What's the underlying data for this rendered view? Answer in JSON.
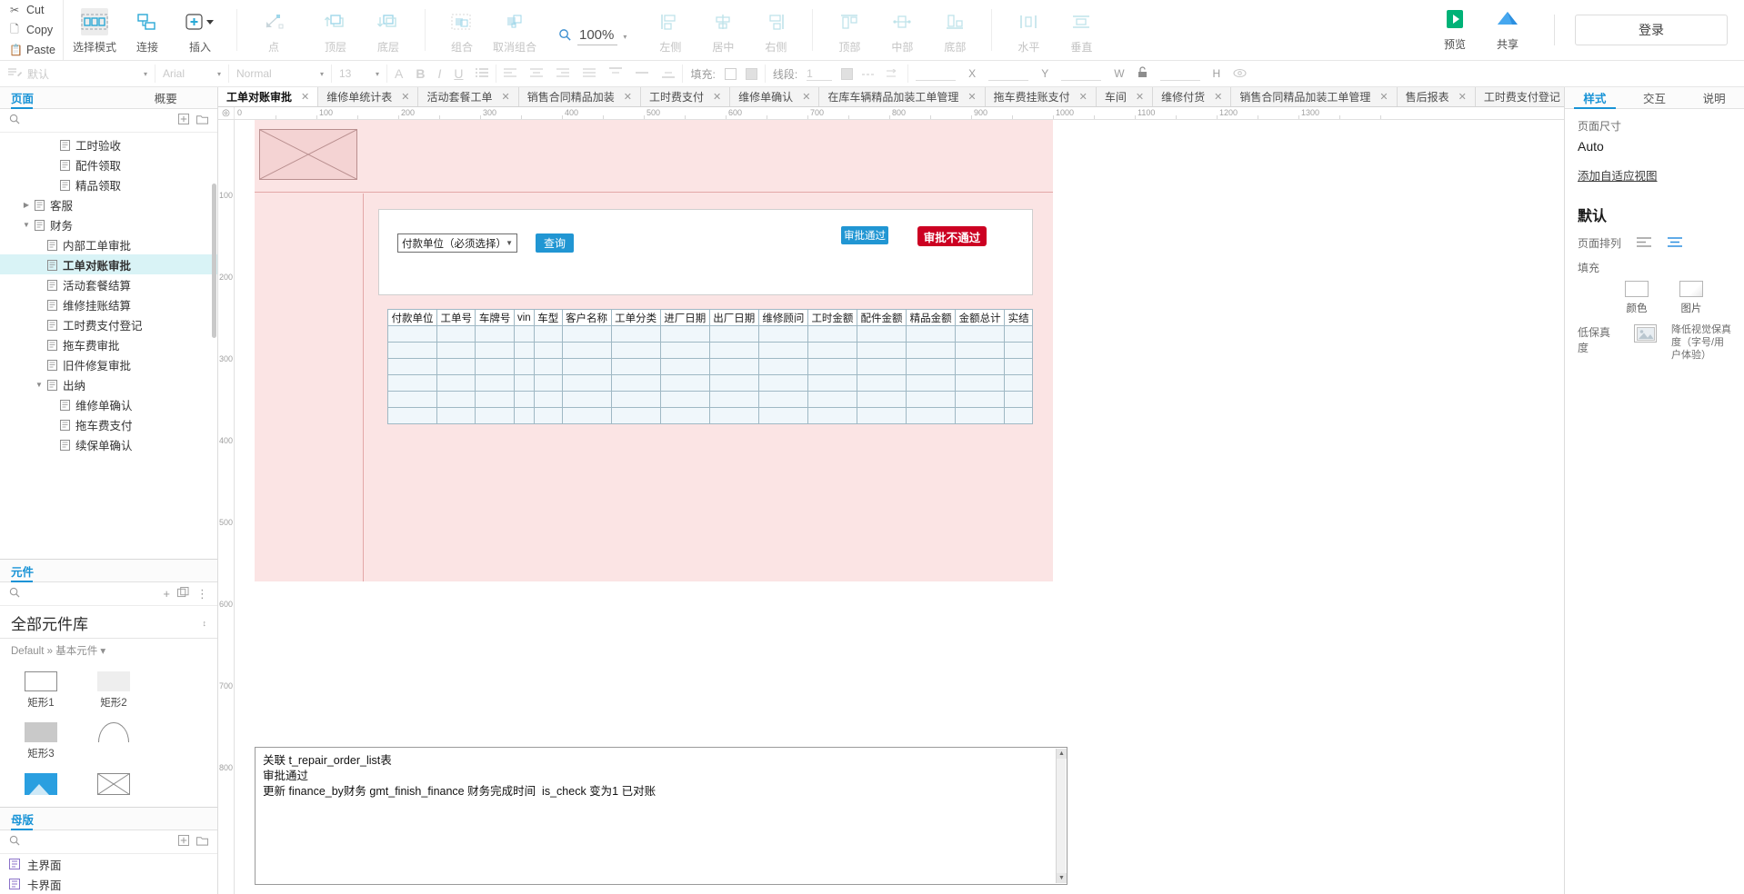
{
  "toolbar": {
    "clipboard": [
      {
        "label": "Cut",
        "icon": "scissors-icon"
      },
      {
        "label": "Copy",
        "icon": "copy-icon"
      },
      {
        "label": "Paste",
        "icon": "clipboard-icon"
      }
    ],
    "groups": [
      {
        "items": [
          {
            "label": "选择模式",
            "icon": "selection-mode-icon",
            "dim": false,
            "selected": true
          },
          {
            "label": "连接",
            "icon": "connect-icon",
            "dim": false,
            "selected": false
          },
          {
            "label": "插入",
            "icon": "insert-plus-icon",
            "dim": false,
            "selected": false,
            "caret": true
          }
        ]
      },
      {
        "items": [
          {
            "label": "点",
            "icon": "point-icon",
            "dim": true,
            "selected": false
          }
        ]
      },
      {
        "items": [
          {
            "label": "顶层",
            "icon": "bring-front-icon",
            "dim": true,
            "selected": false
          },
          {
            "label": "底层",
            "icon": "send-back-icon",
            "dim": true,
            "selected": false
          }
        ]
      },
      {
        "items": [
          {
            "label": "组合",
            "icon": "group-icon",
            "dim": true,
            "selected": false
          },
          {
            "label": "取消组合",
            "icon": "ungroup-icon",
            "dim": true,
            "selected": false
          }
        ]
      }
    ],
    "zoom": {
      "icon": "magnifier-icon",
      "value": "100%"
    },
    "align_groups": [
      {
        "items": [
          {
            "label": "左侧",
            "icon": "align-left-icon"
          },
          {
            "label": "居中",
            "icon": "align-center-icon"
          },
          {
            "label": "右侧",
            "icon": "align-right-icon"
          }
        ]
      },
      {
        "items": [
          {
            "label": "顶部",
            "icon": "align-top-icon"
          },
          {
            "label": "中部",
            "icon": "align-middle-icon"
          },
          {
            "label": "底部",
            "icon": "align-bottom-icon"
          }
        ]
      },
      {
        "items": [
          {
            "label": "水平",
            "icon": "distribute-horizontal-icon"
          },
          {
            "label": "垂直",
            "icon": "distribute-vertical-icon"
          }
        ]
      }
    ],
    "publish": [
      {
        "label": "预览",
        "icon": "preview-play-icon"
      },
      {
        "label": "共享",
        "icon": "share-cloud-icon"
      }
    ],
    "login_label": "登录"
  },
  "format_bar": {
    "style_icon": "text-style-icon",
    "style_value": "默认",
    "font_family": "Arial",
    "font_weight": "Normal",
    "font_size": "13",
    "text_buttons": [
      {
        "icon": "font-color-icon",
        "label": "A"
      },
      {
        "icon": "bold-icon",
        "label": "B"
      },
      {
        "icon": "italic-icon",
        "label": "I"
      },
      {
        "icon": "underline-icon",
        "label": "U"
      },
      {
        "icon": "bullet-list-icon",
        "label": "≔"
      }
    ],
    "align_buttons": [
      {
        "icon": "text-align-left-icon"
      },
      {
        "icon": "text-align-center-icon"
      },
      {
        "icon": "text-align-right-icon"
      },
      {
        "icon": "text-align-justify-icon"
      },
      {
        "icon": "vertical-align-top-icon"
      },
      {
        "icon": "vertical-align-middle-icon"
      },
      {
        "icon": "vertical-align-bottom-icon"
      }
    ],
    "fill_label": "填充:",
    "line_label": "线段:",
    "line_width": "1",
    "position_fields": [
      {
        "label": "X",
        "value": ""
      },
      {
        "label": "Y",
        "value": ""
      },
      {
        "label": "W",
        "value": ""
      },
      {
        "label": "H",
        "value": ""
      }
    ],
    "lock_icon": "lock-icon",
    "visibility_icon": "eye-icon"
  },
  "left_panel": {
    "tabs": [
      {
        "label": "页面",
        "active": true
      },
      {
        "label": "概要",
        "active": false
      }
    ],
    "search_icon": "search-icon",
    "add_icon": "add-page-icon",
    "folder_icon": "folder-icon",
    "tree": [
      {
        "label": "工时验收",
        "depth": 3,
        "twisty": "",
        "selected": false
      },
      {
        "label": "配件领取",
        "depth": 3,
        "twisty": "",
        "selected": false
      },
      {
        "label": "精品领取",
        "depth": 3,
        "twisty": "",
        "selected": false
      },
      {
        "label": "客服",
        "depth": 1,
        "twisty": "▶",
        "selected": false
      },
      {
        "label": "财务",
        "depth": 1,
        "twisty": "▼",
        "selected": false
      },
      {
        "label": "内部工单审批",
        "depth": 2,
        "twisty": "",
        "selected": false
      },
      {
        "label": "工单对账审批",
        "depth": 2,
        "twisty": "",
        "selected": true
      },
      {
        "label": "活动套餐结算",
        "depth": 2,
        "twisty": "",
        "selected": false
      },
      {
        "label": "维修挂账结算",
        "depth": 2,
        "twisty": "",
        "selected": false
      },
      {
        "label": "工时费支付登记",
        "depth": 2,
        "twisty": "",
        "selected": false
      },
      {
        "label": "拖车费审批",
        "depth": 2,
        "twisty": "",
        "selected": false
      },
      {
        "label": "旧件修复审批",
        "depth": 2,
        "twisty": "",
        "selected": false
      },
      {
        "label": "出纳",
        "depth": 2,
        "twisty": "▼",
        "selected": false
      },
      {
        "label": "维修单确认",
        "depth": 3,
        "twisty": "",
        "selected": false
      },
      {
        "label": "拖车费支付",
        "depth": 3,
        "twisty": "",
        "selected": false
      },
      {
        "label": "续保单确认",
        "depth": 3,
        "twisty": "",
        "selected": false
      }
    ],
    "library": {
      "tab_label": "元件",
      "search_icon": "search-icon",
      "add_icon": "plus-icon",
      "menu_icon": "more-options-icon",
      "title": "全部元件库",
      "title_caret": "chevron-updown-icon",
      "breadcrumb": "Default » 基本元件 ▾",
      "widgets": [
        {
          "label": "矩形1",
          "shape": "rect-outline"
        },
        {
          "label": "矩形2",
          "shape": "rect-light"
        },
        {
          "label": "矩形3",
          "shape": "rect-grey"
        },
        {
          "label": "",
          "shape": "arc"
        },
        {
          "label": "",
          "shape": "image"
        },
        {
          "label": "",
          "shape": "placeholder"
        }
      ]
    },
    "masters": {
      "tab_label": "母版",
      "search_icon": "search-icon",
      "add_icon": "add-master-icon",
      "folder_icon": "folder-icon",
      "items": [
        {
          "label": "主界面",
          "icon": "master-icon"
        },
        {
          "label": "卡界面",
          "icon": "master-icon"
        }
      ]
    }
  },
  "document_tabs": [
    {
      "label": "工单对账审批",
      "active": true
    },
    {
      "label": "维修单统计表",
      "active": false
    },
    {
      "label": "活动套餐工单",
      "active": false
    },
    {
      "label": "销售合同精品加装",
      "active": false
    },
    {
      "label": "工时费支付",
      "active": false
    },
    {
      "label": "维修单确认",
      "active": false
    },
    {
      "label": "在库车辆精品加装工单管理",
      "active": false
    },
    {
      "label": "拖车费挂账支付",
      "active": false
    },
    {
      "label": "车间",
      "active": false
    },
    {
      "label": "维修付货",
      "active": false
    },
    {
      "label": "销售合同精品加装工单管理",
      "active": false
    },
    {
      "label": "售后报表",
      "active": false
    },
    {
      "label": "工时费支付登记",
      "active": false
    }
  ],
  "ruler": {
    "origin_icon": "ruler-origin-icon",
    "h_ticks": [
      "0",
      "100",
      "200",
      "300",
      "400",
      "500",
      "600",
      "700",
      "800",
      "900",
      "1000",
      "1100",
      "1200",
      "1300"
    ],
    "v_ticks": [
      "100",
      "200",
      "300",
      "400",
      "500",
      "600",
      "700",
      "800"
    ]
  },
  "canvas": {
    "placeholder_icon": "image-placeholder-icon",
    "form": {
      "select_value": "付款单位（必须选择）",
      "select_caret": "chevron-down-icon",
      "query_button": "查询",
      "approve_button": "审批通过",
      "reject_button": "审批不通过",
      "approve_color": "#2196d3",
      "reject_color": "#cc0022"
    },
    "table": {
      "headers": [
        "付款单位",
        "工单号",
        "车牌号",
        "vin",
        "车型",
        "客户名称",
        "工单分类",
        "进厂日期",
        "出厂日期",
        "维修顾问",
        "工时金额",
        "配件金额",
        "精品金额",
        "金额总计",
        "实结"
      ],
      "row_count": 6
    },
    "notes": [
      "关联 t_repair_order_list表",
      "审批通过",
      "更新 finance_by财务 gmt_finish_finance 财务完成时间  is_check 变为1 已对账"
    ]
  },
  "right_panel": {
    "tabs": [
      {
        "label": "样式",
        "active": true
      },
      {
        "label": "交互",
        "active": false
      },
      {
        "label": "说明",
        "active": false
      }
    ],
    "page_size_label": "页面尺寸",
    "page_size_value": "Auto",
    "adaptive_link": "添加自适应视图",
    "default_heading": "默认",
    "page_align_label": "页面排列",
    "page_align_icons": [
      "align-page-left-icon",
      "align-page-center-icon"
    ],
    "fill_label": "填充",
    "fill_options": [
      {
        "caption": "颜色",
        "icon": "color-swatch-icon"
      },
      {
        "caption": "图片",
        "icon": "image-swatch-icon"
      }
    ],
    "fidelity_label": "低保真度",
    "fidelity_icon": "image-icon",
    "fidelity_note": "降低视觉保真度（字号/用户体验）"
  }
}
